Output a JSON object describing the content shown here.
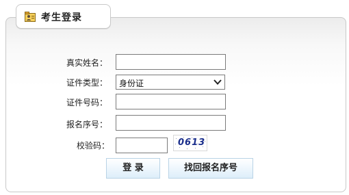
{
  "header": {
    "title": "考生登录",
    "icon": "student-card-icon"
  },
  "form": {
    "name_label": "真实姓名：",
    "name_value": "",
    "id_type_label": "证件类型：",
    "id_type_value": "身份证",
    "id_number_label": "证件号码：",
    "id_number_value": "",
    "reg_number_label": "报名序号：",
    "reg_number_value": "",
    "captcha_label": "校验码：",
    "captcha_value": "",
    "captcha_text": "0613"
  },
  "buttons": {
    "login_label": "登 录",
    "recover_label": "找回报名序号"
  },
  "colors": {
    "button_border": "#b9d3e6",
    "captcha_text": "#1a2e8c",
    "panel_border": "#c8c8c8"
  }
}
